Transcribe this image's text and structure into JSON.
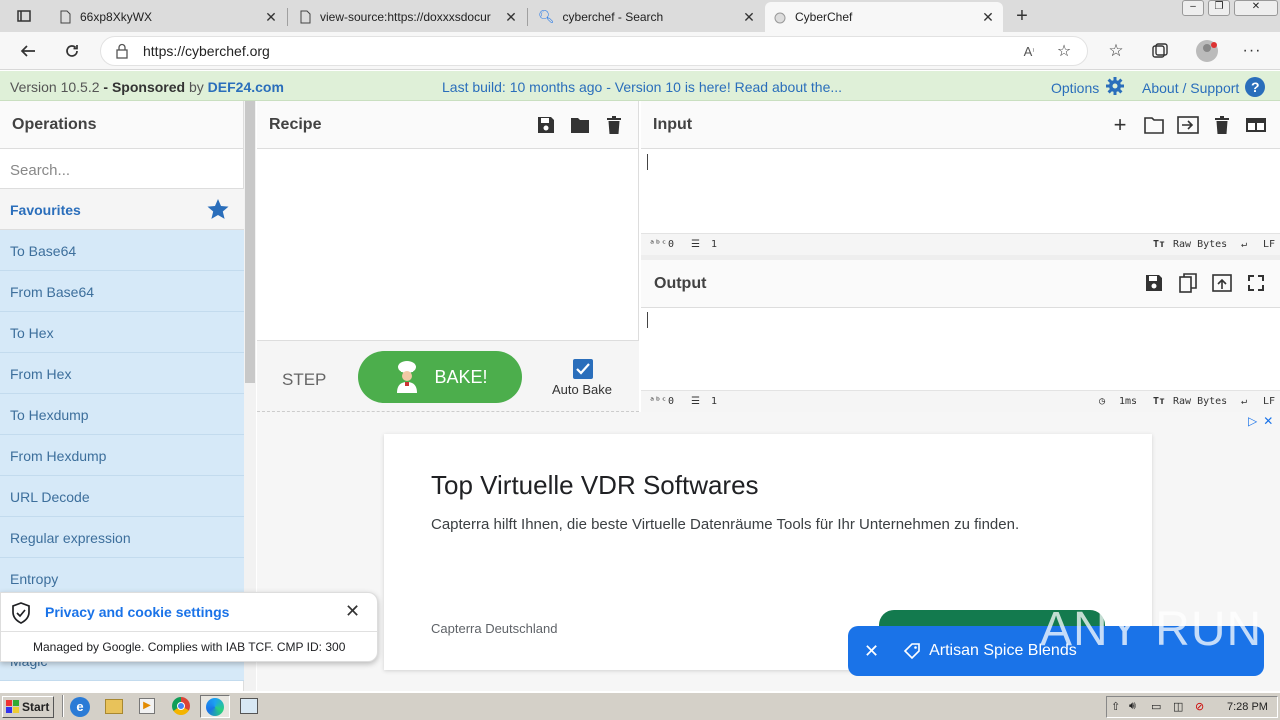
{
  "browser": {
    "tabs": [
      {
        "title": "66xp8XkyWX",
        "active": false
      },
      {
        "title": "view-source:https://doxxxsdocur",
        "active": false
      },
      {
        "title": "cyberchef - Search",
        "active": false
      },
      {
        "title": "CyberChef",
        "active": true
      }
    ],
    "url": "https://cyberchef.org"
  },
  "banner": {
    "version": "Version 10.5.2",
    "sponsored": " - Sponsored",
    "by": " by ",
    "sponsor": "DEF24.com",
    "notice": "Last build: 10 months ago - Version 10 is here! Read about the...",
    "options": "Options",
    "about": "About / Support",
    "help": "?"
  },
  "operations": {
    "title": "Operations",
    "search_placeholder": "Search...",
    "favourites": "Favourites",
    "items": [
      "To Base64",
      "From Base64",
      "To Hex",
      "From Hex",
      "To Hexdump",
      "From Hexdump",
      "URL Decode",
      "Regular expression",
      "Entropy",
      "Magic"
    ]
  },
  "recipe": {
    "title": "Recipe",
    "step": "STEP",
    "bake": "BAKE!",
    "auto_bake": "Auto Bake"
  },
  "input": {
    "title": "Input",
    "chars": "0",
    "lines": "1",
    "raw": "Raw Bytes",
    "eol": "LF"
  },
  "output": {
    "title": "Output",
    "chars": "0",
    "lines": "1",
    "time": "1ms",
    "raw": "Raw Bytes",
    "eol": "LF"
  },
  "ad": {
    "title": "Top Virtuelle VDR Softwares",
    "description": "Capterra hilft Ihnen, die beste Virtuelle Datenräume Tools für Ihr Unternehmen zu finden.",
    "source": "Capterra Deutschland",
    "popup": "Artisan Spice Blends"
  },
  "privacy": {
    "title": "Privacy and cookie settings",
    "subtitle": "Managed by Google. Complies with IAB TCF. CMP ID: 300"
  },
  "watermark": "ANY RUN",
  "taskbar": {
    "start": "Start",
    "clock": "7:28 PM"
  }
}
